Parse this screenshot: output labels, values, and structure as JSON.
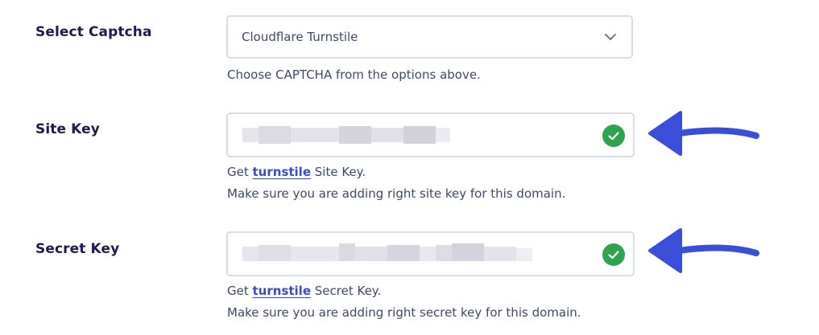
{
  "captcha": {
    "label": "Select Captcha",
    "selected": "Cloudflare Turnstile",
    "help": "Choose CAPTCHA from the options above.",
    "dropdown_icon": "chevron-down-icon"
  },
  "site_key": {
    "label": "Site Key",
    "help_prefix": "Get ",
    "help_link": "turnstile",
    "help_suffix": " Site Key.",
    "note": "Make sure you are adding right site key for this domain.",
    "status_icon": "check-circle-icon"
  },
  "secret_key": {
    "label": "Secret Key",
    "help_prefix": "Get ",
    "help_link": "turnstile",
    "help_suffix": " Secret Key.",
    "note": "Make sure you are adding right secret key for this domain.",
    "status_icon": "check-circle-icon"
  },
  "colors": {
    "success": "#2ea44f",
    "arrow": "#3a4fd8",
    "link": "#3a4cbf",
    "label": "#1d1b4b"
  }
}
